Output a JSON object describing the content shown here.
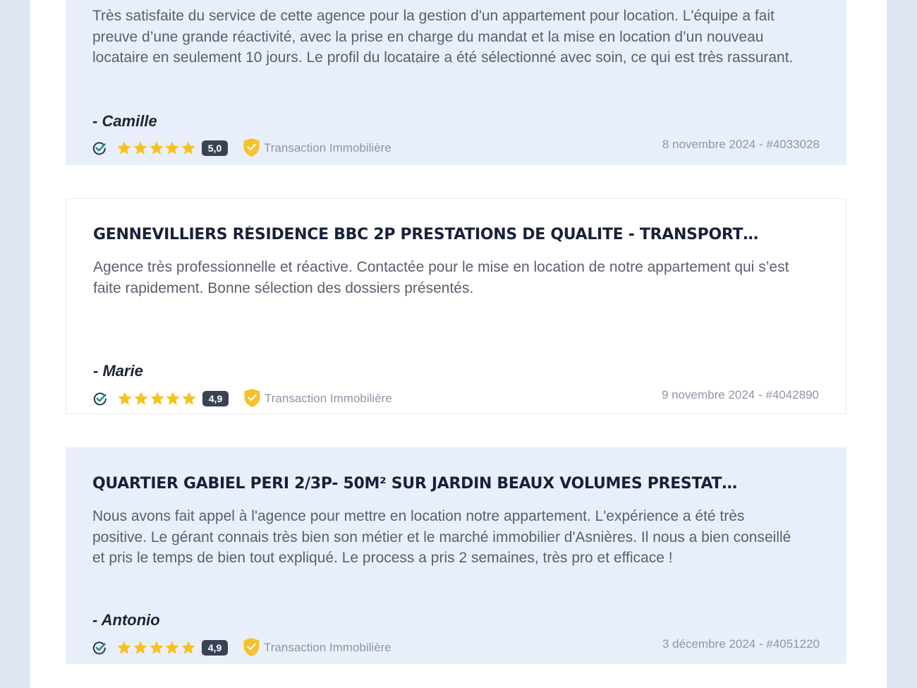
{
  "reviews": [
    {
      "title": "",
      "text": "Très satisfaite du service de cette agence pour la gestion d'un appartement pour location. L'équipe a fait preuve d’une grande réactivité, avec la prise en charge du mandat et la mise en location d’un nouveau locataire en seulement 10 jours. Le profil du locataire a été sélectionné avec soin, ce qui est très rassurant.",
      "author": "- Camille",
      "rating": 5.0,
      "score_label": "5,0",
      "category": "Transaction Immobilière",
      "date_ref": "8 novembre 2024 - #4033028"
    },
    {
      "title": "GENNEVILLIERS RÉSIDENCE BBC 2P PRESTATIONS DE QUALITE - TRANSPORT…",
      "text": "Agence très professionnelle et réactive. Contactée pour le mise en location de notre appartement qui s’est faite rapidement. Bonne sélection des dossiers présentés.",
      "author": "- Marie",
      "rating": 4.9,
      "score_label": "4,9",
      "category": "Transaction Immobilière",
      "date_ref": "9 novembre 2024 - #4042890"
    },
    {
      "title": "QUARTIER GABIEL PERI 2/3P- 50M² SUR JARDIN BEAUX VOLUMES PRESTAT…",
      "text": "Nous avons fait appel à l'agence pour mettre en location notre appartement. L'expérience a été très positive. Le gérant connais très bien son métier et le marché immobilier d'Asnières. Il nous a bien conseillé et pris le temps de bien tout expliqué. Le process a pris 2 semaines, très pro et efficace !",
      "author": "- Antonio",
      "rating": 4.9,
      "score_label": "4,9",
      "category": "Transaction Immobilière",
      "date_ref": "3 décembre 2024 - #4051220"
    }
  ],
  "icons": {
    "verified": "verified-check-icon",
    "star": "star-icon",
    "category": "shield-check-icon"
  },
  "colors": {
    "star": "#f6c21c",
    "shield": "#f5c12e",
    "verified": "#1f8a8a",
    "score_badge": "#3a4354",
    "shaded_card": "#e9effa",
    "page_background": "#dfe7f5"
  }
}
